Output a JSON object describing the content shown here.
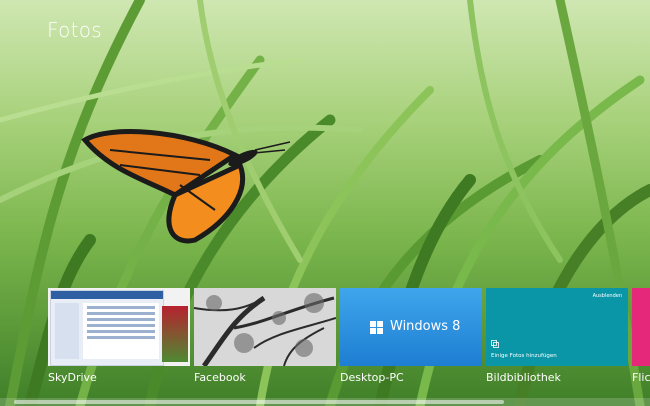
{
  "app": {
    "title": "Fotos"
  },
  "tiles": [
    {
      "id": "skydrive",
      "label": "SkyDrive"
    },
    {
      "id": "facebook",
      "label": "Facebook"
    },
    {
      "id": "desktop-pc",
      "label": "Desktop-PC",
      "tile_text": "Windows 8"
    },
    {
      "id": "bildbibliothek",
      "label": "Bildbibliothek",
      "hide_label": "Ausblenden",
      "add_text": "Einige Fotos hinzufügen"
    },
    {
      "id": "flickr",
      "label": "Flickr"
    }
  ],
  "colors": {
    "desktop_tile": "#1e7ed2",
    "library_tile": "#0b96a8",
    "flickr_tile": "#e6287a"
  }
}
